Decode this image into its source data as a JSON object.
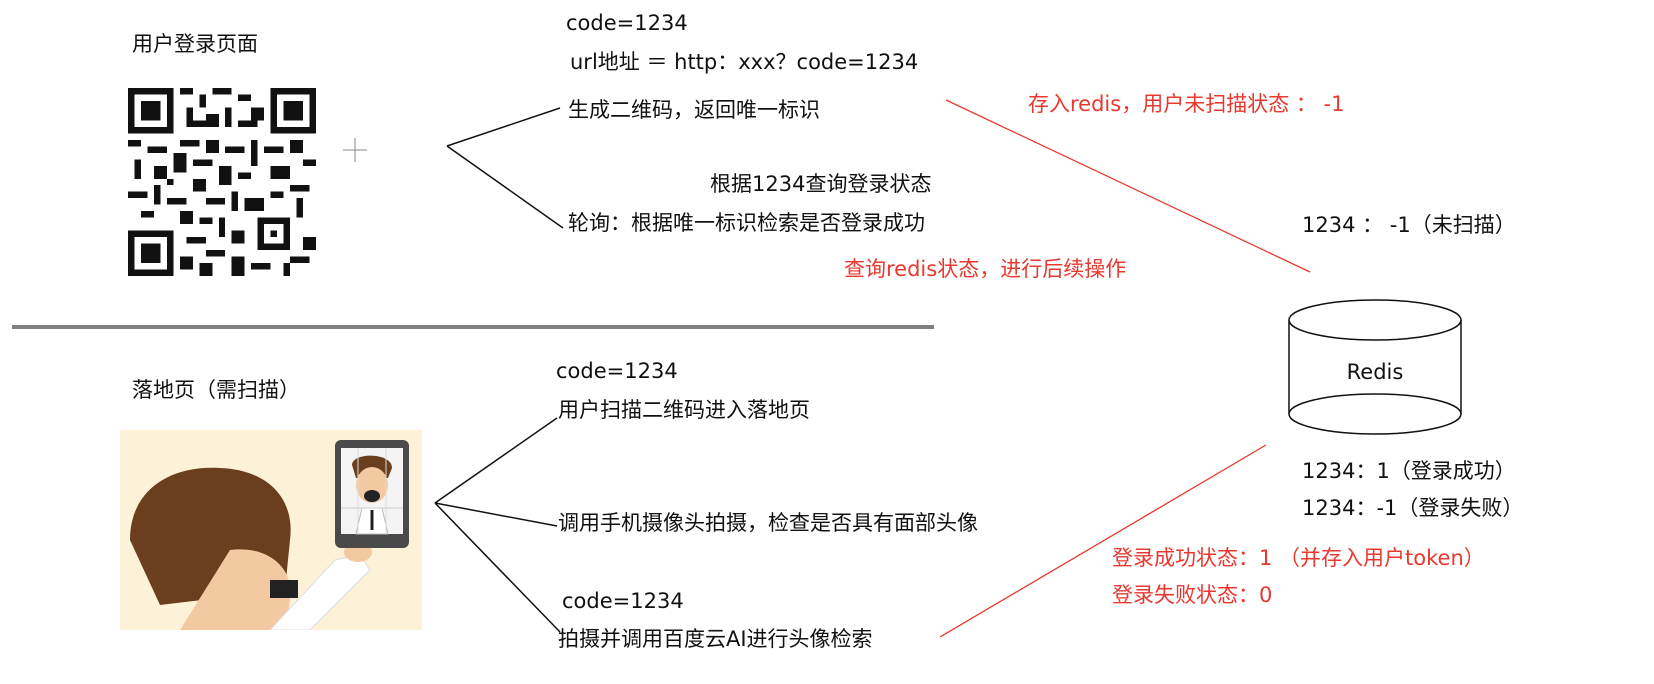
{
  "top": {
    "title": "用户登录页面",
    "code": "code=1234",
    "url": "url地址  ＝  http：xxx？code=1234",
    "gen": "生成二维码，返回唯一标识",
    "query_by_code": "根据1234查询登录状态",
    "poll": "轮询：根据唯一标识检索是否登录成功",
    "red_store": "存入redis，用户未扫描状态 ： -1",
    "red_query": "查询redis状态，进行后续操作"
  },
  "bottom": {
    "title": "落地页（需扫描）",
    "code1": "code=1234",
    "scan": "用户扫描二维码进入落地页",
    "camera": "调用手机摄像头拍摄，检查是否具有面部头像",
    "code2": "code=1234",
    "shoot": "拍摄并调用百度云AI进行头像检索",
    "red_success": "登录成功状态：1 （并存入用户token）",
    "red_fail": "登录失败状态：0"
  },
  "redis": {
    "label": "Redis",
    "state_unscanned": "1234 ： -1（未扫描）",
    "state_success": "1234：1（登录成功）",
    "state_fail": "1234：-1（登录失败）"
  },
  "colors": {
    "accent_red": "#e8382f",
    "divider": "#808080"
  }
}
